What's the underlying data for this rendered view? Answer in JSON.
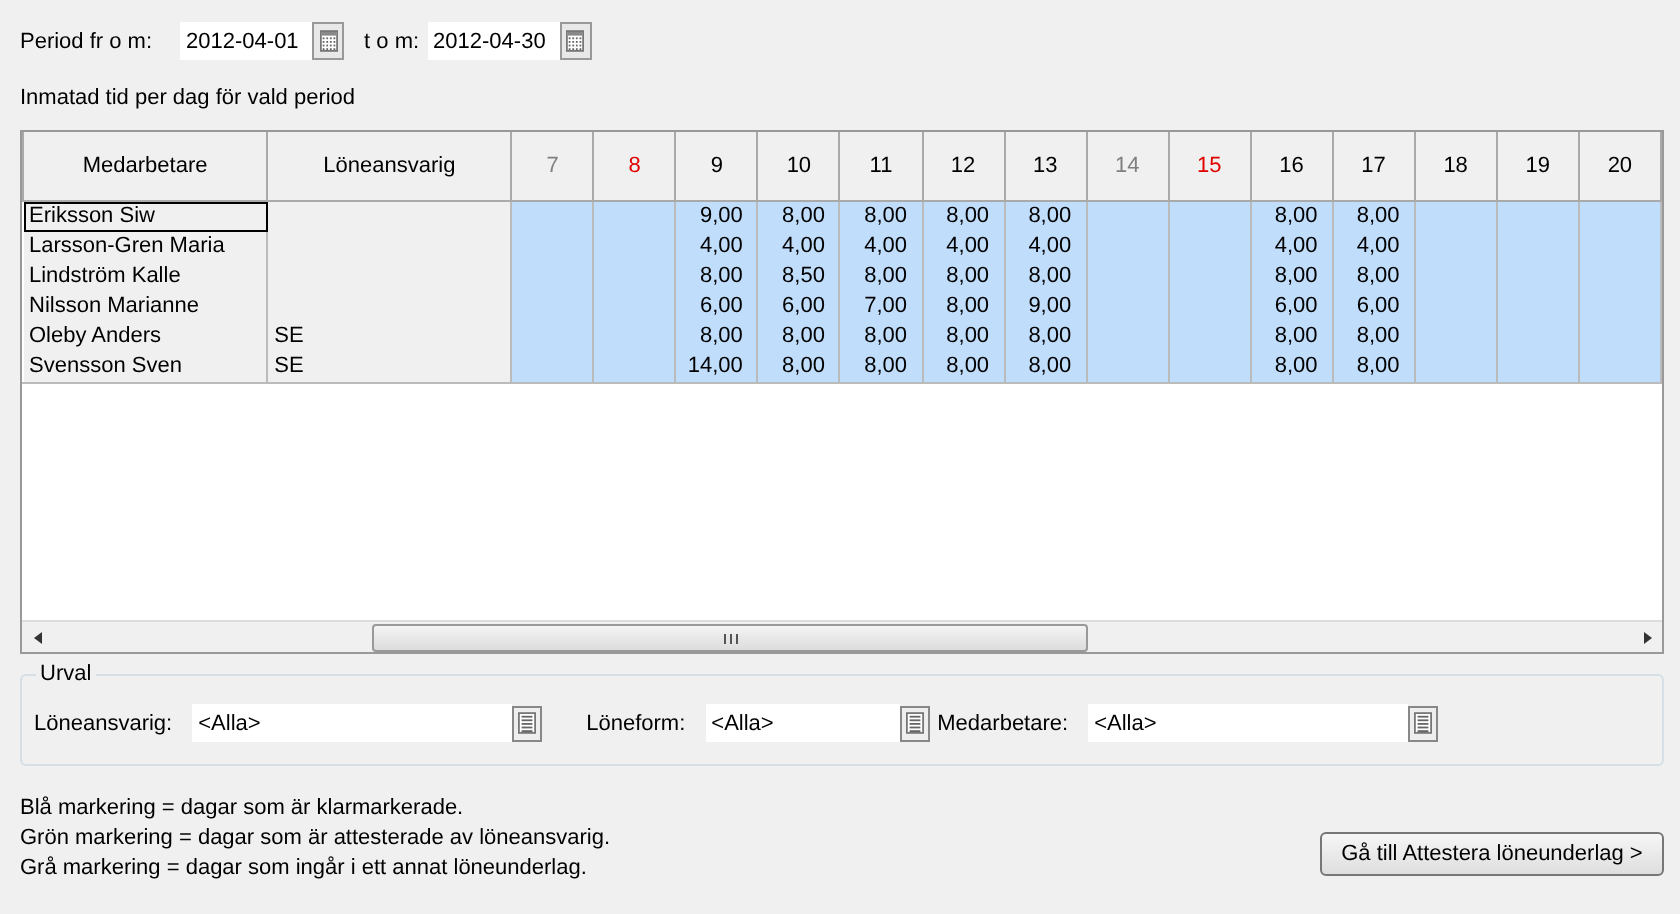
{
  "period": {
    "from_label": "Period fr o m:",
    "from_value": "2012-04-01",
    "to_label": "t o m:",
    "to_value": "2012-04-30"
  },
  "grid_title": "Inmatad tid per dag för vald period",
  "table": {
    "columns": [
      {
        "label": "Medarbetare"
      },
      {
        "label": "Löneansvarig"
      }
    ],
    "days": [
      {
        "label": "7",
        "kind": "saturday"
      },
      {
        "label": "8",
        "kind": "holiday"
      },
      {
        "label": "9",
        "kind": "weekday"
      },
      {
        "label": "10",
        "kind": "weekday"
      },
      {
        "label": "11",
        "kind": "weekday"
      },
      {
        "label": "12",
        "kind": "weekday"
      },
      {
        "label": "13",
        "kind": "weekday"
      },
      {
        "label": "14",
        "kind": "saturday"
      },
      {
        "label": "15",
        "kind": "holiday"
      },
      {
        "label": "16",
        "kind": "weekday"
      },
      {
        "label": "17",
        "kind": "weekday"
      },
      {
        "label": "18",
        "kind": "weekday"
      },
      {
        "label": "19",
        "kind": "weekday"
      },
      {
        "label": "20",
        "kind": "weekday"
      }
    ],
    "rows": [
      {
        "name": "Eriksson Siw",
        "focused": true,
        "cells": [
          {
            "color": "#c0ddfb"
          },
          {
            "color": "#c0ddfb"
          },
          {
            "value": "9,00",
            "color": "#c0ddfb"
          },
          {
            "value": "8,00",
            "color": "#c0ddfb"
          },
          {
            "value": "8,00",
            "color": "#c0ddfb"
          },
          {
            "value": "8,00",
            "color": "#c0ddfb"
          },
          {
            "value": "8,00",
            "color": "#c0ddfb"
          },
          {
            "color": "#c0ddfb"
          },
          {
            "color": "#c0ddfb"
          },
          {
            "value": "8,00",
            "color": "#c0ddfb"
          },
          {
            "value": "8,00",
            "color": "#c0ddfb"
          },
          {
            "color": "#c0ddfb"
          },
          {
            "color": "#c0ddfb"
          },
          {
            "color": "#c0ddfb"
          }
        ]
      },
      {
        "name": "Larsson-Gren Maria",
        "focused": false,
        "cells": [
          {
            "color": "#c0ddfb"
          },
          {
            "color": "#c0ddfb"
          },
          {
            "value": "4,00",
            "color": "#c0ddfb"
          },
          {
            "value": "4,00",
            "color": "#c0ddfb"
          },
          {
            "value": "4,00",
            "color": "#c0ddfb"
          },
          {
            "value": "4,00",
            "color": "#c0ddfb"
          },
          {
            "value": "4,00",
            "color": "#c0ddfb"
          },
          {
            "color": "#c0ddfb"
          },
          {
            "color": "#c0ddfb"
          },
          {
            "value": "4,00",
            "color": "#c0ddfb"
          },
          {
            "value": "4,00",
            "color": "#c0ddfb"
          },
          {
            "color": "#c0ddfb"
          },
          {
            "color": "#c0ddfb"
          },
          {
            "color": "#c0ddfb"
          }
        ]
      },
      {
        "name": "Lindström Kalle",
        "focused": false,
        "cells": [
          {
            "color": "#c0ddfb"
          },
          {
            "color": "#c0ddfb"
          },
          {
            "value": "8,00",
            "color": "#c0ddfb"
          },
          {
            "value": "8,50",
            "color": "#c0ddfb"
          },
          {
            "value": "8,00",
            "color": "#c0ddfb"
          },
          {
            "value": "8,00",
            "color": "#c0ddfb"
          },
          {
            "value": "8,00",
            "color": "#c0ddfb"
          },
          {
            "color": "#c0ddfb"
          },
          {
            "color": "#c0ddfb"
          },
          {
            "value": "8,00",
            "color": "#c0ddfb"
          },
          {
            "value": "8,00",
            "color": "#c0ddfb"
          },
          {
            "color": "#c0ddfb"
          },
          {
            "color": "#c0ddfb"
          },
          {
            "color": "#c0ddfb"
          }
        ]
      },
      {
        "name": "Nilsson Marianne",
        "focused": false,
        "cells": [
          {
            "color": "#c0ddfb"
          },
          {
            "color": "#c0ddfb"
          },
          {
            "value": "6,00",
            "color": "#c0ddfb"
          },
          {
            "value": "6,00",
            "color": "#c0ddfb"
          },
          {
            "value": "7,00",
            "color": "#c0ddfb"
          },
          {
            "value": "8,00",
            "color": "#c0ddfb"
          },
          {
            "value": "9,00",
            "color": "#c0ddfb"
          },
          {
            "color": "#c0ddfb"
          },
          {
            "color": "#c0ddfb"
          },
          {
            "value": "6,00",
            "color": "#c0ddfb"
          },
          {
            "value": "6,00",
            "color": "#c0ddfb"
          },
          {
            "color": "#c0ddfb"
          },
          {
            "color": "#c0ddfb"
          },
          {
            "color": "#c0ddfb"
          }
        ]
      },
      {
        "name": "Oleby Anders",
        "manager": "SE",
        "focused": false,
        "cells": [
          {
            "color": "#c0ddfb"
          },
          {
            "color": "#c0ddfb"
          },
          {
            "value": "8,00",
            "color": "#c0ddfb"
          },
          {
            "value": "8,00",
            "color": "#c0ddfb"
          },
          {
            "value": "8,00",
            "color": "#c0ddfb"
          },
          {
            "value": "8,00",
            "color": "#c0ddfb"
          },
          {
            "value": "8,00",
            "color": "#c0ddfb"
          },
          {
            "color": "#c0ddfb"
          },
          {
            "color": "#c0ddfb"
          },
          {
            "value": "8,00",
            "color": "#c0ddfb"
          },
          {
            "value": "8,00",
            "color": "#c0ddfb"
          },
          {
            "color": "#c0ddfb"
          },
          {
            "color": "#c0ddfb"
          },
          {
            "color": "#c0ddfb"
          }
        ]
      },
      {
        "name": "Svensson Sven",
        "manager": "SE",
        "focused": false,
        "cells": [
          {
            "color": "#c0ddfb"
          },
          {
            "color": "#c0ddfb"
          },
          {
            "value": "14,00",
            "color": "#c0ddfb"
          },
          {
            "value": "8,00",
            "color": "#c0ddfb"
          },
          {
            "value": "8,00",
            "color": "#c0ddfb"
          },
          {
            "value": "8,00",
            "color": "#c0ddfb"
          },
          {
            "value": "8,00",
            "color": "#c0ddfb"
          },
          {
            "color": "#c0ddfb"
          },
          {
            "color": "#c0ddfb"
          },
          {
            "value": "8,00",
            "color": "#c0ddfb"
          },
          {
            "value": "8,00",
            "color": "#c0ddfb"
          },
          {
            "color": "#c0ddfb"
          },
          {
            "color": "#c0ddfb"
          },
          {
            "color": "#c0ddfb"
          }
        ]
      }
    ]
  },
  "filter": {
    "title": "Urval",
    "fields": [
      {
        "label": "Löneansvarig:",
        "value": "<Alla>"
      },
      {
        "label": "Löneform:",
        "value": "<Alla>"
      },
      {
        "label": "Medarbetare:",
        "value": "<Alla>"
      }
    ]
  },
  "legend": [
    "Blå markering = dagar som är klarmarkerade.",
    "Grön markering = dagar som är attesterade av löneansvarig.",
    "Grå markering = dagar som ingår i ett annat löneunderlag."
  ],
  "next_button": "Gå till Attestera löneunderlag >"
}
